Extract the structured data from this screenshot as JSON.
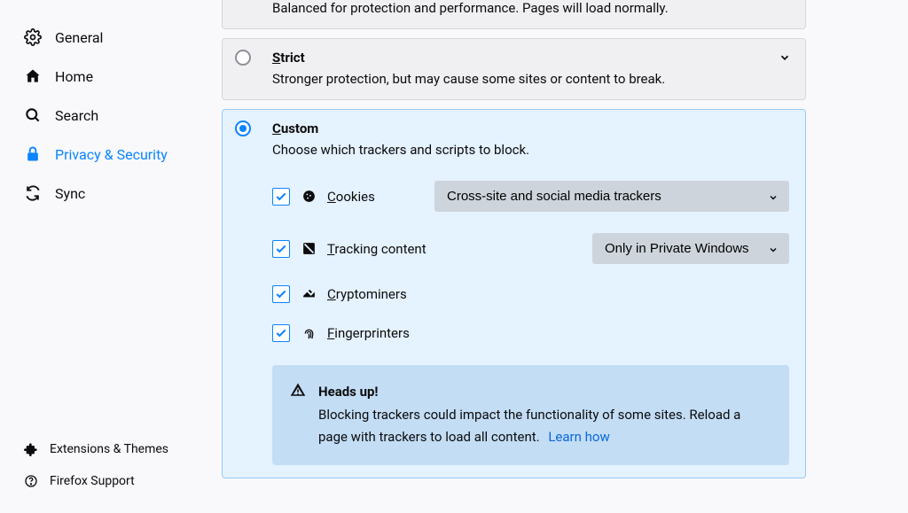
{
  "sidebar": {
    "items": [
      {
        "label": "General"
      },
      {
        "label": "Home"
      },
      {
        "label": "Search"
      },
      {
        "label": "Privacy & Security"
      },
      {
        "label": "Sync"
      }
    ],
    "bottom": [
      {
        "label": "Extensions & Themes"
      },
      {
        "label": "Firefox Support"
      }
    ]
  },
  "tracking": {
    "standard": {
      "desc": "Balanced for protection and performance. Pages will load normally."
    },
    "strict": {
      "title": "Strict",
      "desc": "Stronger protection, but may cause some sites or content to break."
    },
    "custom": {
      "title": "Custom",
      "desc": "Choose which trackers and scripts to block.",
      "rows": {
        "cookies": {
          "label": "Cookies",
          "dropdown": "Cross-site and social media trackers"
        },
        "tracking_content": {
          "label": "Tracking content",
          "dropdown": "Only in Private Windows"
        },
        "cryptominers": {
          "label": "Cryptominers"
        },
        "fingerprinters": {
          "label": "Fingerprinters"
        }
      },
      "warning": {
        "title": "Heads up!",
        "body": "Blocking trackers could impact the functionality of some sites. Reload a page with trackers to load all content.",
        "learn": "Learn how"
      }
    }
  }
}
